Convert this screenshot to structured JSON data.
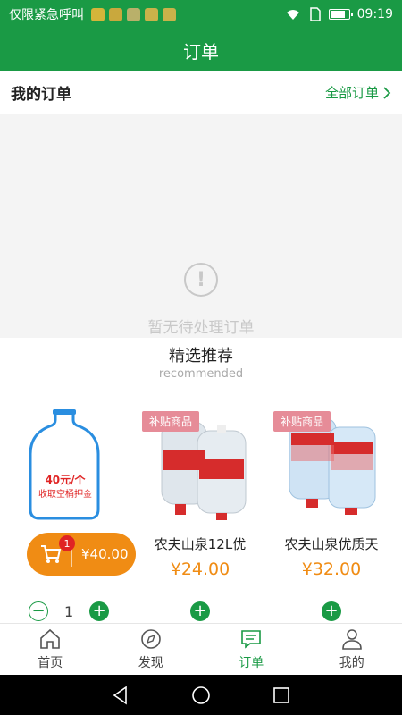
{
  "status_bar": {
    "carrier": "仅限紧急呼叫",
    "time": "09:19",
    "app_icon_colors": [
      "#d4b53a",
      "#c9a83d",
      "#b9b06a",
      "#c9b24a",
      "#c9b24a"
    ]
  },
  "header": {
    "title": "订单"
  },
  "orders_row": {
    "label": "我的订单",
    "all_label": "全部订单"
  },
  "empty_state": {
    "icon": "exclamation-circle-icon",
    "text": "暂无待处理订单"
  },
  "recommended": {
    "title": "精选推荐",
    "subtitle": "recommended",
    "bottle_label_price": "40元/个",
    "bottle_label_desc": "收取空桶押金",
    "products": [
      {
        "name": "农夫山泉12L优",
        "price": "¥24.00",
        "tag": "补贴商品"
      },
      {
        "name": "农夫山泉优质天",
        "price": "¥32.00",
        "tag": "补贴商品"
      }
    ],
    "qty_count": "1"
  },
  "cart": {
    "badge": "1",
    "total": "¥40.00"
  },
  "tabbar": {
    "items": [
      {
        "label": "首页",
        "icon": "home-icon"
      },
      {
        "label": "发现",
        "icon": "compass-icon"
      },
      {
        "label": "订单",
        "icon": "order-chat-icon",
        "active": true
      },
      {
        "label": "我的",
        "icon": "user-icon"
      }
    ]
  },
  "colors": {
    "brand": "#1a9a45",
    "accent": "#f08c14",
    "tag": "#e68c98",
    "badge": "#e02424"
  }
}
